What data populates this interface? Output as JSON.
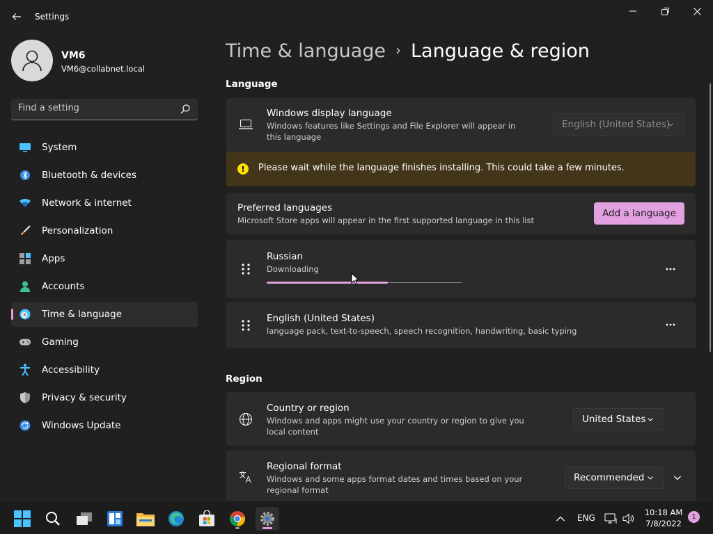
{
  "window": {
    "title": "Settings"
  },
  "user": {
    "name": "VM6",
    "email": "VM6@collabnet.local"
  },
  "search": {
    "placeholder": "Find a setting"
  },
  "nav": {
    "items": [
      {
        "label": "System",
        "icon": "system-icon",
        "active": false
      },
      {
        "label": "Bluetooth & devices",
        "icon": "bluetooth-icon",
        "active": false
      },
      {
        "label": "Network & internet",
        "icon": "wifi-icon",
        "active": false
      },
      {
        "label": "Personalization",
        "icon": "brush-icon",
        "active": false
      },
      {
        "label": "Apps",
        "icon": "apps-icon",
        "active": false
      },
      {
        "label": "Accounts",
        "icon": "person-icon",
        "active": false
      },
      {
        "label": "Time & language",
        "icon": "globe-clock-icon",
        "active": true
      },
      {
        "label": "Gaming",
        "icon": "gamepad-icon",
        "active": false
      },
      {
        "label": "Accessibility",
        "icon": "accessibility-icon",
        "active": false
      },
      {
        "label": "Privacy & security",
        "icon": "shield-icon",
        "active": false
      },
      {
        "label": "Windows Update",
        "icon": "update-icon",
        "active": false
      }
    ]
  },
  "breadcrumb": {
    "parent": "Time & language",
    "separator": "›",
    "current": "Language & region"
  },
  "language_section": {
    "title": "Language",
    "display_language": {
      "title": "Windows display language",
      "description": "Windows features like Settings and File Explorer will appear in this language",
      "selected": "English (United States)"
    },
    "warning": "Please wait while the language finishes installing. This could take a few minutes.",
    "preferred": {
      "title": "Preferred languages",
      "description": "Microsoft Store apps will appear in the first supported language in this list",
      "add_button": "Add a language"
    },
    "languages": [
      {
        "name": "Russian",
        "status": "Downloading",
        "progress": 0.62
      },
      {
        "name": "English (United States)",
        "status": "language pack, text-to-speech, speech recognition, handwriting, basic typing"
      }
    ]
  },
  "region_section": {
    "title": "Region",
    "country": {
      "title": "Country or region",
      "description": "Windows and apps might use your country or region to give you local content",
      "selected": "United States"
    },
    "format": {
      "title": "Regional format",
      "description": "Windows and some apps format dates and times based on your regional format",
      "selected": "Recommended"
    }
  },
  "taskbar": {
    "apps": [
      "start-icon",
      "search-icon",
      "task-view-icon",
      "widgets-icon",
      "file-explorer-icon",
      "edge-icon",
      "store-icon",
      "chrome-icon",
      "settings-icon"
    ],
    "language": "ENG",
    "time": "10:18 AM",
    "date": "7/8/2022",
    "notifications": "1"
  },
  "colors": {
    "accent": "#e3a0e0",
    "background": "#202020",
    "card": "#2b2b2b",
    "warning_bg": "#433519",
    "warning_icon": "#fce100"
  }
}
